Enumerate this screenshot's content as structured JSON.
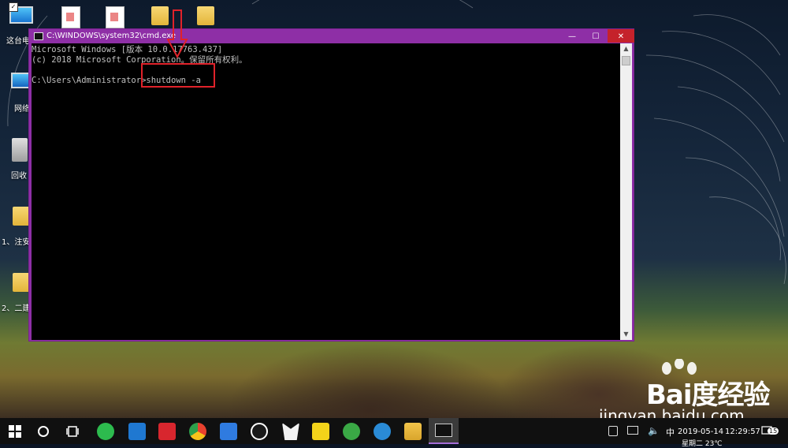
{
  "desktop": {
    "icons": [
      {
        "label": "这台电"
      },
      {
        "label": "网络"
      },
      {
        "label": "回收"
      },
      {
        "label": "1、注安"
      },
      {
        "label": "2、二建"
      }
    ]
  },
  "window": {
    "title": "C:\\WINDOWS\\system32\\cmd.exe",
    "buttons": {
      "minimize": "—",
      "maximize": "☐",
      "close": "✕"
    }
  },
  "console": {
    "lines": [
      "Microsoft Windows [版本 10.0.17763.437]",
      "(c) 2018 Microsoft Corporation。保留所有权利。",
      "",
      "C:\\Users\\Administrator>shutdown -a"
    ]
  },
  "annotation": {
    "color": "#e0222a"
  },
  "watermark": {
    "brand": "Bai度经验",
    "url": "jingyan.baidu.com"
  },
  "taskbar": {
    "apps": [
      {
        "name": "wechat-icon",
        "color": "#2dbb4e"
      },
      {
        "name": "outlook-icon",
        "color": "#1f78d1"
      },
      {
        "name": "ithome-icon",
        "color": "#d8262e"
      },
      {
        "name": "chrome-icon",
        "color": "#e8b01c"
      },
      {
        "name": "baidu-netdisk-icon",
        "color": "#2f7be0"
      },
      {
        "name": "qq-icon",
        "color": "#ffffff"
      },
      {
        "name": "fox-icon",
        "color": "#ffffff"
      },
      {
        "name": "notes-icon",
        "color": "#f3d31a"
      },
      {
        "name": "360-browser-icon",
        "color": "#3aa845"
      },
      {
        "name": "ie-icon",
        "color": "#2a8bd6"
      },
      {
        "name": "file-explorer-icon",
        "color": "#f2c44a"
      },
      {
        "name": "cmd-icon",
        "color": "#111111"
      }
    ],
    "tray": {
      "ime": "中",
      "date": "2019-05-14",
      "time": "12:29:57",
      "weather": "星期二  23℃",
      "notifications": "15"
    }
  },
  "colors": {
    "window_frame": "#8e2fa6",
    "close_button": "#c5222b",
    "console_bg": "#000000",
    "console_text": "#c0c0c0"
  }
}
